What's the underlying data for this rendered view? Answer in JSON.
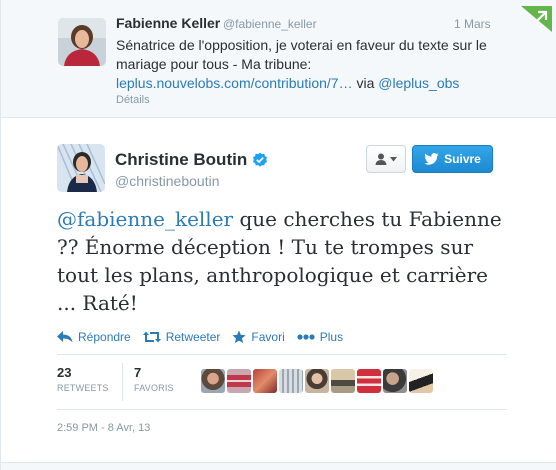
{
  "reply_tweet": {
    "name": "Fabienne Keller",
    "handle": "@fabienne_keller",
    "date": "1 Mars",
    "text_prefix": "Sénatrice de l'opposition, je voterai en faveur du texte sur le mariage pour tous - Ma tribune: ",
    "link": "leplus.nouvelobs.com/contribution/7…",
    "via": " via ",
    "via_handle": "@leplus_obs",
    "details_label": "Détails"
  },
  "main_tweet": {
    "name": "Christine Boutin",
    "verified_icon": "verified-badge-icon",
    "handle": "@christineboutin",
    "follow_label": "Suivre",
    "mention": "@fabienne_keller",
    "text": " que cherches tu Fabienne ?? Énorme déception ! Tu te trompes sur tout les plans, anthropologique et carrière ... Raté!",
    "actions": {
      "reply": "Répondre",
      "retweet": "Retweeter",
      "favorite": "Favori",
      "more": "Plus"
    },
    "stats": {
      "retweets_count": "23",
      "retweets_label": "RETWEETS",
      "favorites_count": "7",
      "favorites_label": "FAVORIS"
    },
    "timestamp": "2:59 PM - 8 Avr, 13"
  },
  "colors": {
    "link": "#2b7bb9",
    "follow_button": "#1d89d1",
    "muted": "#8899a6",
    "verified": "#1da1f2"
  }
}
